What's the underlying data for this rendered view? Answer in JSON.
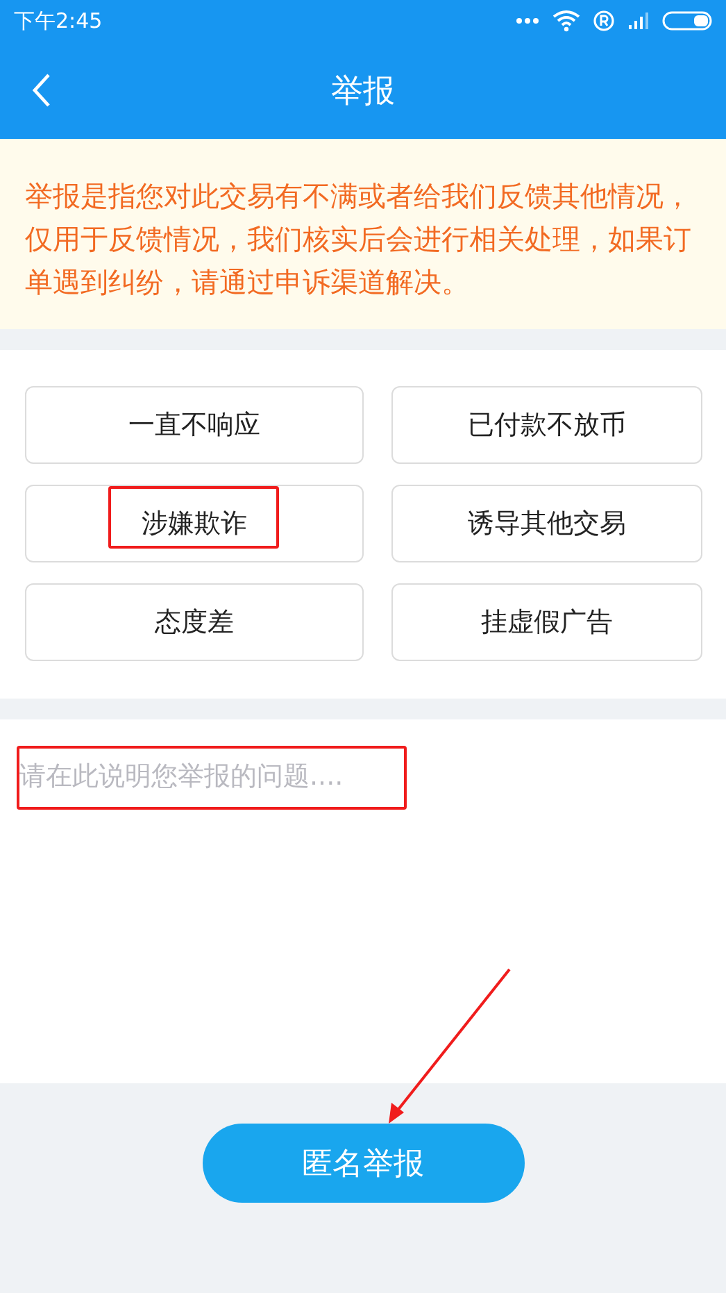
{
  "status_bar": {
    "time": "下午2:45"
  },
  "nav": {
    "title": "举报"
  },
  "notice": "举报是指您对此交易有不满或者给我们反馈其他情况，仅用于反馈情况，我们核实后会进行相关处理，如果订单遇到纠纷，请通过申诉渠道解决。",
  "reasons": [
    "一直不响应",
    "已付款不放币",
    "涉嫌欺诈",
    "诱导其他交易",
    "态度差",
    "挂虚假广告"
  ],
  "description": {
    "placeholder": "请在此说明您举报的问题...."
  },
  "submit_button": "匿名举报"
}
